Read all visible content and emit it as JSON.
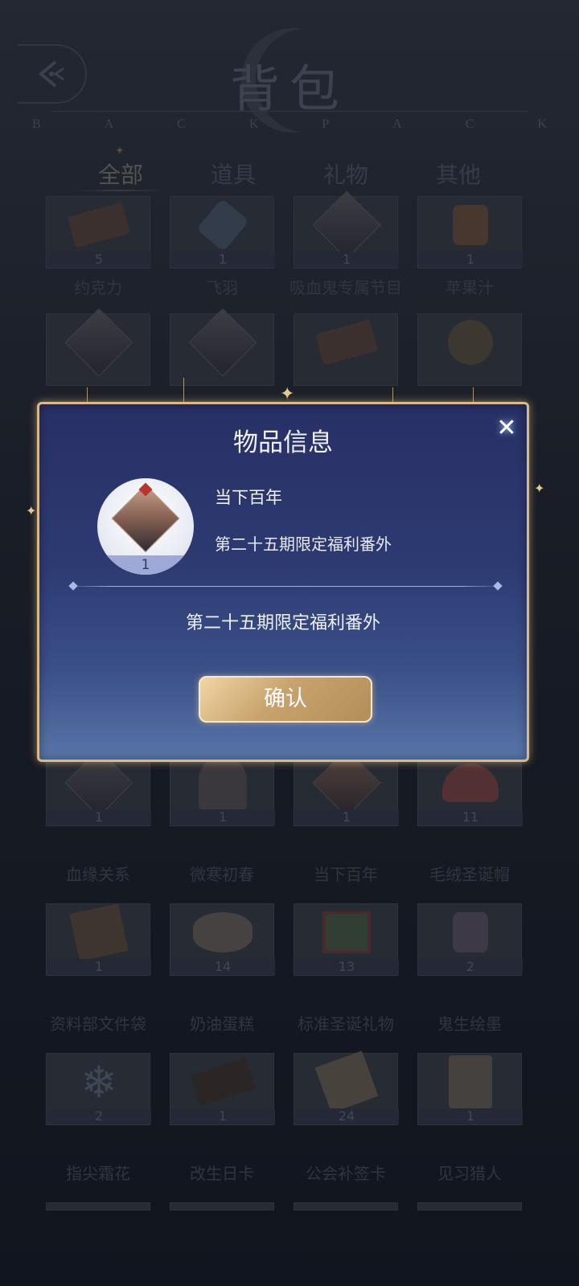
{
  "header": {
    "title": "背包",
    "subtitle_letters": [
      "B",
      "A",
      "C",
      "K",
      "P",
      "A",
      "C",
      "K"
    ]
  },
  "tabs": [
    "全部",
    "道具",
    "礼物",
    "其他"
  ],
  "grid_items": [
    {
      "name": "约克力",
      "count": "5"
    },
    {
      "name": "飞羽",
      "count": "1"
    },
    {
      "name": "吸血鬼专属节目",
      "count": "1"
    },
    {
      "name": "苹果汁",
      "count": "1"
    },
    {
      "name": "血缘关系",
      "count": "1"
    },
    {
      "name": "微寒初春",
      "count": "1"
    },
    {
      "name": "当下百年",
      "count": "1"
    },
    {
      "name": "毛绒圣诞帽",
      "count": "11"
    },
    {
      "name": "资料部文件袋",
      "count": "1"
    },
    {
      "name": "奶油蛋糕",
      "count": "14"
    },
    {
      "name": "标准圣诞礼物",
      "count": "13"
    },
    {
      "name": "鬼生绘墨",
      "count": "2"
    },
    {
      "name": "指尖霜花",
      "count": "2"
    },
    {
      "name": "改生日卡",
      "count": "1"
    },
    {
      "name": "公会补签卡",
      "count": "24"
    },
    {
      "name": "见习猎人",
      "count": "1"
    }
  ],
  "modal": {
    "title": "物品信息",
    "item_name": "当下百年",
    "item_subtitle": "第二十五期限定福利番外",
    "item_count": "1",
    "description": "第二十五期限定福利番外",
    "confirm_label": "确认"
  },
  "colors": {
    "modal_border": "#d8b98a",
    "modal_bg_top": "#283066",
    "button_gold": "#c9a36d"
  }
}
